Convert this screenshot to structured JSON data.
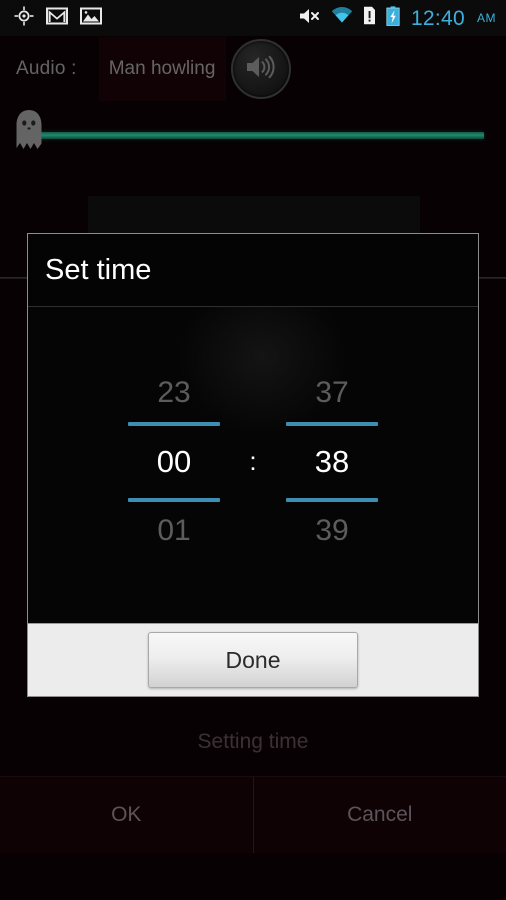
{
  "statusbar": {
    "left_icons": [
      {
        "name": "location-icon",
        "label": "GPS"
      },
      {
        "name": "gmail-icon",
        "label": "Gmail"
      },
      {
        "name": "gallery-image-icon",
        "label": "Image"
      }
    ],
    "right_icons": [
      {
        "name": "volume-mute-icon",
        "label": "Muted"
      },
      {
        "name": "wifi-icon",
        "label": "Wi-Fi"
      },
      {
        "name": "sdcard-warning-icon",
        "label": "SD card"
      },
      {
        "name": "battery-charging-icon",
        "label": "Charging"
      }
    ],
    "clock": "12:40",
    "meridiem": "AM",
    "clock_color": "#3cb0dd"
  },
  "app": {
    "audio": {
      "label": "Audio :",
      "selected_sound": "Man howling",
      "play_button_icon": "speaker-icon"
    },
    "seekbar": {
      "thumb_icon": "ghost-icon",
      "value_position": "0",
      "track_color": "#2fd8a8"
    },
    "status_text": "Setting time",
    "buttons": {
      "ok": "OK",
      "cancel": "Cancel"
    }
  },
  "dialog": {
    "title": "Set time",
    "hour_picker": {
      "previous": "23",
      "current": "00",
      "next": "01"
    },
    "separator": ":",
    "minute_picker": {
      "previous": "37",
      "current": "38",
      "next": "39"
    },
    "done_label": "Done",
    "accent_color": "#3e8db3"
  }
}
